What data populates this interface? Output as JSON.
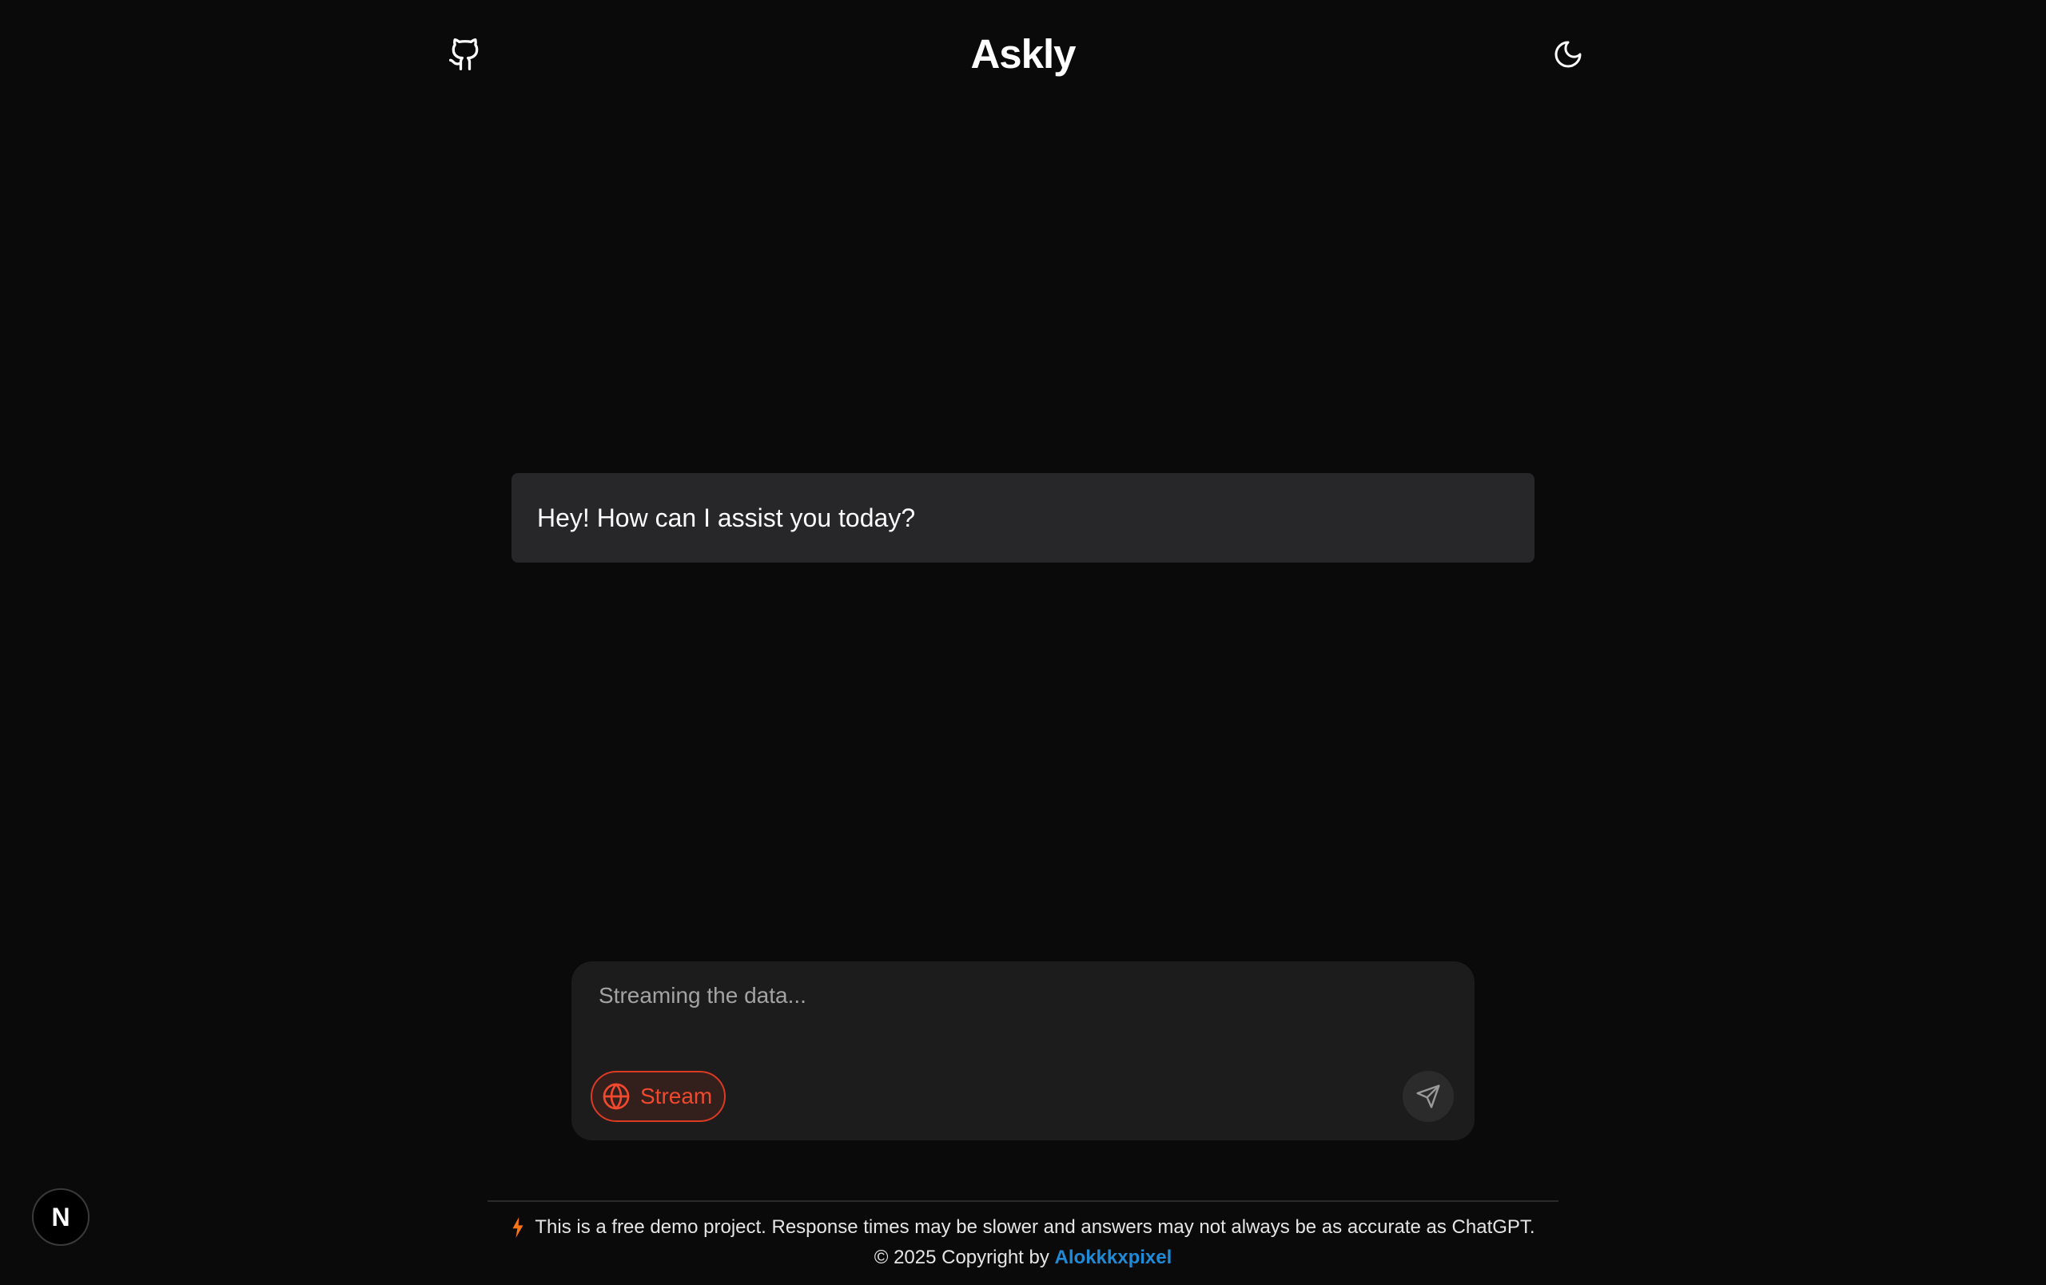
{
  "header": {
    "title": "Askly",
    "github_icon": "github-icon",
    "theme_icon": "moon-icon"
  },
  "chat": {
    "messages": [
      {
        "role": "assistant",
        "text": "Hey! How can I assist you today?"
      }
    ]
  },
  "composer": {
    "placeholder": "Streaming the data...",
    "value": "",
    "stream_label": "Stream",
    "stream_icon": "globe-icon",
    "send_icon": "send-icon"
  },
  "footer": {
    "note_icon": "lightning-icon",
    "note": "This is a free demo project. Response times may be slower and answers may not always be as accurate as ChatGPT.",
    "copyright_prefix": "© 2025 Copyright by",
    "author": "Alokkkxpixel"
  },
  "dev_badge": {
    "letter": "N"
  },
  "colors": {
    "background": "#0a0a0a",
    "message_bubble": "#27272a",
    "composer": "#1c1c1c",
    "stream_accent": "#f0492e",
    "author_link": "#1f8ad6",
    "lightning": "#f97316"
  }
}
